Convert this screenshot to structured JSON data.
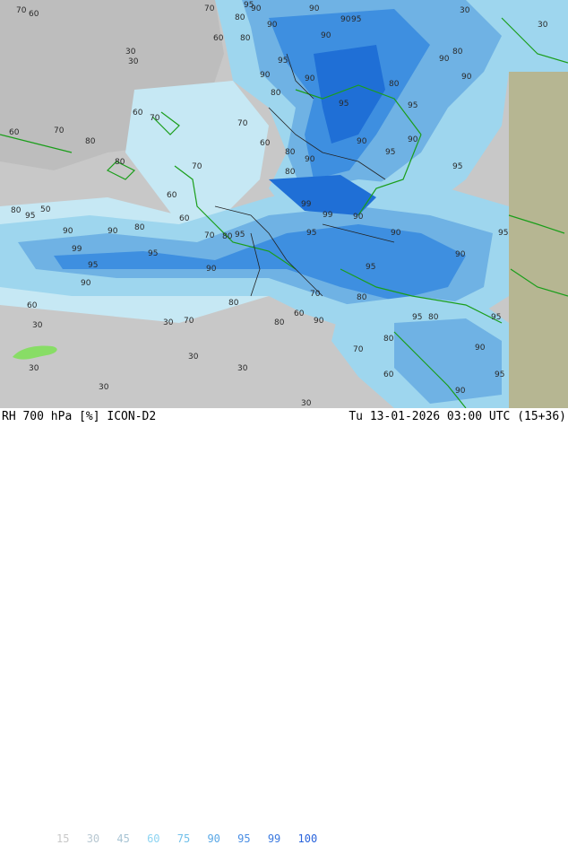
{
  "map": {
    "contour_labels": [
      "70",
      "60",
      "30",
      "30",
      "90",
      "95",
      "90",
      "80",
      "70",
      "60",
      "80",
      "90",
      "30",
      "30",
      "60",
      "70",
      "80",
      "90",
      "95",
      "90",
      "90",
      "80",
      "95",
      "90",
      "95",
      "90",
      "80",
      "60",
      "70",
      "80",
      "90",
      "95",
      "90",
      "80",
      "70",
      "60",
      "80",
      "90",
      "95",
      "90",
      "95",
      "80",
      "70",
      "60",
      "50",
      "80",
      "90",
      "95",
      "99",
      "70",
      "60",
      "80",
      "95",
      "90",
      "95",
      "90",
      "80",
      "95",
      "99",
      "90",
      "95",
      "90",
      "80",
      "70",
      "60",
      "80",
      "90",
      "95",
      "80",
      "90",
      "95",
      "95",
      "90",
      "95",
      "90",
      "80",
      "70",
      "60",
      "30",
      "30",
      "30",
      "60",
      "70",
      "80",
      "90",
      "95",
      "99",
      "30",
      "30",
      "30",
      "30"
    ],
    "colors": {
      "background": "#c8c8c8",
      "rh60": "#c6e8f4",
      "rh75": "#9ed6ee",
      "rh90": "#6fb2e4",
      "rh95": "#3e8fe0",
      "rh99": "#1f6fd6",
      "land_edge": "#b6b692",
      "border": "#1a9e1a"
    }
  },
  "footer": {
    "left": "RH 700 hPa [%] ICON-D2",
    "right": "Tu 13-01-2026 03:00 UTC (15+36)",
    "legend": [
      {
        "label": "15",
        "color": "#c8c8c8"
      },
      {
        "label": "30",
        "color": "#b8c8d2"
      },
      {
        "label": "45",
        "color": "#a8c4d4"
      },
      {
        "label": "60",
        "color": "#8ed4f2"
      },
      {
        "label": "75",
        "color": "#72c0ea"
      },
      {
        "label": "90",
        "color": "#5aa8e6"
      },
      {
        "label": "95",
        "color": "#4a8ee4"
      },
      {
        "label": "99",
        "color": "#3c7ae0"
      },
      {
        "label": "100",
        "color": "#2a64dc"
      }
    ]
  }
}
